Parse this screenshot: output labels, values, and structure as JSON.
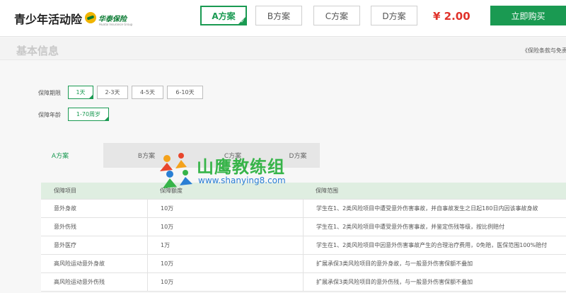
{
  "header": {
    "title": "青少年活动险",
    "logo_text": "华泰保险",
    "logo_sub": "Huatai Insurance Group",
    "plans": [
      "A方案",
      "B方案",
      "C方案",
      "D方案"
    ],
    "active_plan_index": 0,
    "price": "¥ 2.00",
    "buy_label": "立即购买"
  },
  "section": {
    "title": "基本信息",
    "terms_link": "《保险条款与免责"
  },
  "options": {
    "period_label": "保障期限",
    "period_choices": [
      "1天",
      "2-3天",
      "4-5天",
      "6-10天"
    ],
    "period_selected": "1天",
    "age_label": "保障年龄",
    "age_choices": [
      "1-70周岁"
    ],
    "age_selected": "1-70周岁"
  },
  "tabs": [
    "A方案",
    "B方案",
    "C方案",
    "D方案"
  ],
  "table": {
    "headers": [
      "保障项目",
      "保障额度",
      "保障范围"
    ],
    "rows": [
      [
        "意外身故",
        "10万",
        "学生在1、2类风险项目中遭受意外伤害事故，并自事故发生之日起180日内因该事故身故"
      ],
      [
        "意外伤残",
        "10万",
        "学生在1、2类风险项目中遭受意外伤害事故，并鉴定伤残等级，按比例赔付"
      ],
      [
        "意外医疗",
        "1万",
        "学生在1、2类风险项目中因意外伤害事故产生的合理治疗费用，0免赔，医保范围100%赔付"
      ],
      [
        "高风险运动意外身故",
        "10万",
        "扩展承保3类风险项目的意外身故，与一般意外伤害保额不叠加"
      ],
      [
        "高风险运动意外伤残",
        "10万",
        "扩展承保3类风险项目的意外伤残，与一般意外伤害保额不叠加"
      ]
    ]
  },
  "watermark": {
    "title": "山鹰教练组",
    "url": "www.shanying8.com"
  },
  "colors": {
    "accent": "#1a9a52",
    "price": "#e0322a",
    "table_head": "#dfeee1"
  }
}
